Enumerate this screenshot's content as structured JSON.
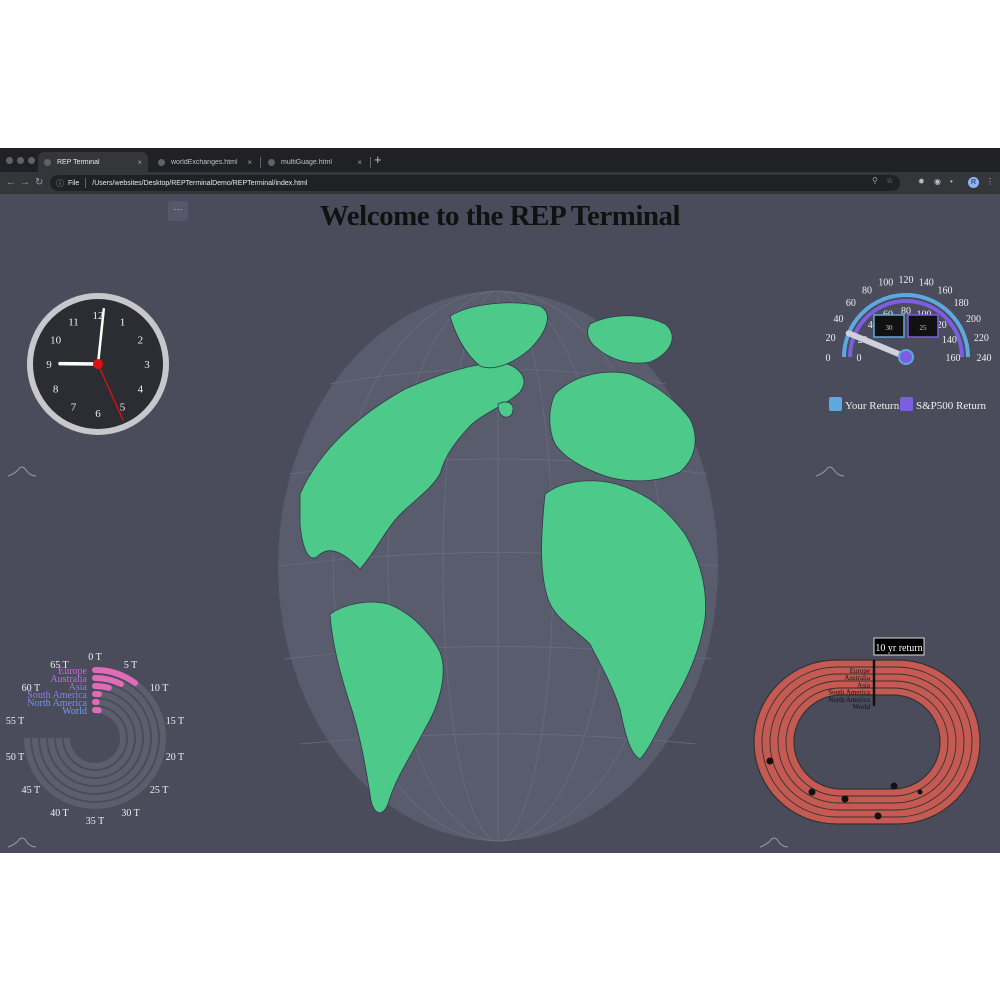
{
  "browser": {
    "tabs": [
      {
        "label": "REP Terminal",
        "active": true
      },
      {
        "label": "worldExchanges.html",
        "active": false
      },
      {
        "label": "multiGuage.html",
        "active": false
      }
    ],
    "new_tab": "+",
    "close_glyph": "×",
    "scheme_label": "File",
    "url": "/Users/websites/Desktop/REPTerminalDemo/REPTerminal/index.html",
    "profile_initial": "R"
  },
  "page": {
    "title": "Welcome to the REP Terminal",
    "more_button": "···"
  },
  "clock": {
    "numerals": [
      "12",
      "1",
      "2",
      "3",
      "4",
      "5",
      "6",
      "7",
      "8",
      "9",
      "10",
      "11"
    ],
    "time": {
      "hour": 9,
      "minute": 1,
      "second": 26
    }
  },
  "gauge": {
    "outer_ticks": [
      "0",
      "20",
      "40",
      "60",
      "80",
      "100",
      "120",
      "140",
      "160",
      "180",
      "200",
      "220",
      "240"
    ],
    "inner_ticks": [
      "0",
      "20",
      "40",
      "60",
      "80",
      "100",
      "120",
      "140",
      "160"
    ],
    "readouts": [
      "30",
      "25"
    ],
    "needle_value": 30,
    "legend": [
      {
        "label": "Your Return",
        "color": "#5ea8e0"
      },
      {
        "label": "S&P500 Return",
        "color": "#7b5fe0"
      }
    ]
  },
  "radial": {
    "regions": [
      "Europe",
      "Australia",
      "Asia",
      "South America",
      "North America",
      "World"
    ],
    "region_colors": [
      "#c86bdc",
      "#b271e0",
      "#9b78e0",
      "#8a7fe6",
      "#7891e8",
      "#6aa4e8"
    ],
    "values_T": [
      7,
      5,
      3,
      1,
      0.5,
      1.5
    ],
    "ticks": [
      "0 T",
      "5 T",
      "10 T",
      "15 T",
      "20 T",
      "25 T",
      "30 T",
      "35 T",
      "40 T",
      "45 T",
      "50 T",
      "55 T",
      "60 T",
      "65 T"
    ],
    "bar_color": "#e06bb8"
  },
  "track": {
    "tooltip": "10 yr return",
    "lanes": [
      "Europe",
      "Australia",
      "Asia",
      "South America",
      "North America",
      "World"
    ]
  },
  "colors": {
    "background": "#4a4c5c",
    "land": "#4dc98a",
    "ocean": "#585c6c",
    "track": "#c45a52"
  }
}
